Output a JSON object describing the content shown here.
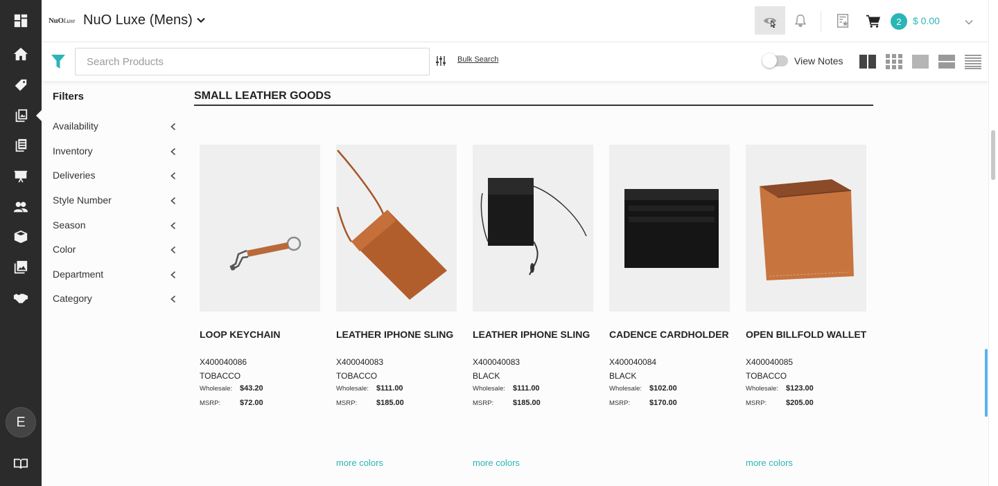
{
  "colors": {
    "accent": "#2bb5b7",
    "rail": "#2b2b2b"
  },
  "rail": {
    "icons": [
      "dashboard-icon",
      "home-icon",
      "tag-icon",
      "catalog-icon",
      "orders-icon",
      "presentation-icon",
      "customers-icon",
      "box-icon",
      "images-icon",
      "handshake-icon"
    ],
    "avatar_initial": "E",
    "footer_icon": "book-icon"
  },
  "header": {
    "logo_text": "NuO",
    "logo_script": "Luxe",
    "brand": "NuO Luxe (Mens)",
    "cart_count": "2",
    "cart_total": "$ 0.00",
    "icons": [
      "eye-icon",
      "bell-icon",
      "notes-icon",
      "cart-icon"
    ]
  },
  "toolbar": {
    "search_placeholder": "Search Products",
    "bulk_search": "Bulk Search",
    "view_notes": "View Notes",
    "view_modes": [
      "two-column-view-icon",
      "grid-view-icon",
      "single-view-icon",
      "row-view-icon",
      "list-view-icon"
    ]
  },
  "filters": {
    "title": "Filters",
    "items": [
      "Availability",
      "Inventory",
      "Deliveries",
      "Style Number",
      "Season",
      "Color",
      "Department",
      "Category"
    ]
  },
  "section": {
    "title": "SMALL LEATHER GOODS"
  },
  "price_labels": {
    "wholesale": "Wholesale:",
    "msrp": "MSRP:"
  },
  "products": [
    {
      "name": "LOOP KEYCHAIN",
      "style": "X400040086",
      "color": "TOBACCO",
      "wholesale": "$43.20",
      "msrp": "$72.00",
      "more_colors": ""
    },
    {
      "name": "LEATHER IPHONE SLING",
      "style": "X400040083",
      "color": "TOBACCO",
      "wholesale": "$111.00",
      "msrp": "$185.00",
      "more_colors": "more colors"
    },
    {
      "name": "LEATHER IPHONE SLING",
      "style": "X400040083",
      "color": "BLACK",
      "wholesale": "$111.00",
      "msrp": "$185.00",
      "more_colors": "more colors"
    },
    {
      "name": "CADENCE CARDHOLDER",
      "style": "X400040084",
      "color": "BLACK",
      "wholesale": "$102.00",
      "msrp": "$170.00",
      "more_colors": ""
    },
    {
      "name": "OPEN BILLFOLD WALLET",
      "style": "X400040085",
      "color": "TOBACCO",
      "wholesale": "$123.00",
      "msrp": "$205.00",
      "more_colors": "more colors"
    }
  ]
}
